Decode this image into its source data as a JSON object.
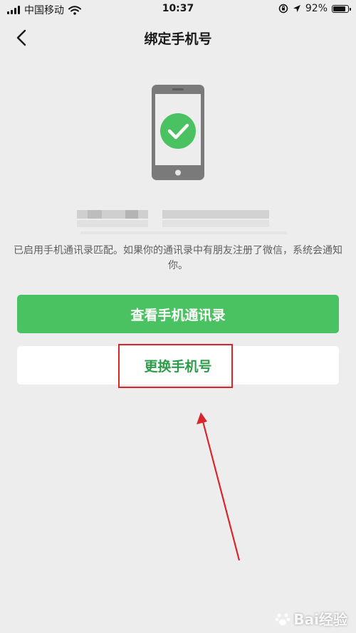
{
  "status_bar": {
    "carrier": "中国移动",
    "time": "10:37",
    "battery": "92%",
    "battery_level": 0.92,
    "wifi_icon": "wifi-icon",
    "location_icon": "location-arrow-icon",
    "lock_icon": "orientation-lock-icon"
  },
  "nav": {
    "title": "绑定手机号",
    "back_icon": "chevron-left-icon"
  },
  "illustration": {
    "icon": "phone-check-icon",
    "phone_color": "#7a7a7a",
    "check_color": "#4bc262"
  },
  "info": {
    "text": "已启用手机通讯录匹配。如果你的通讯录中有朋友注册了微信，系统会通知你。"
  },
  "buttons": {
    "view_contacts": "查看手机通讯录",
    "change_phone": "更换手机号"
  },
  "colors": {
    "primary": "#4bc262",
    "secondary_text": "#2d9c48",
    "annotation": "#d8262c",
    "background": "#ededed"
  },
  "watermark": {
    "text": "Bai经验"
  }
}
